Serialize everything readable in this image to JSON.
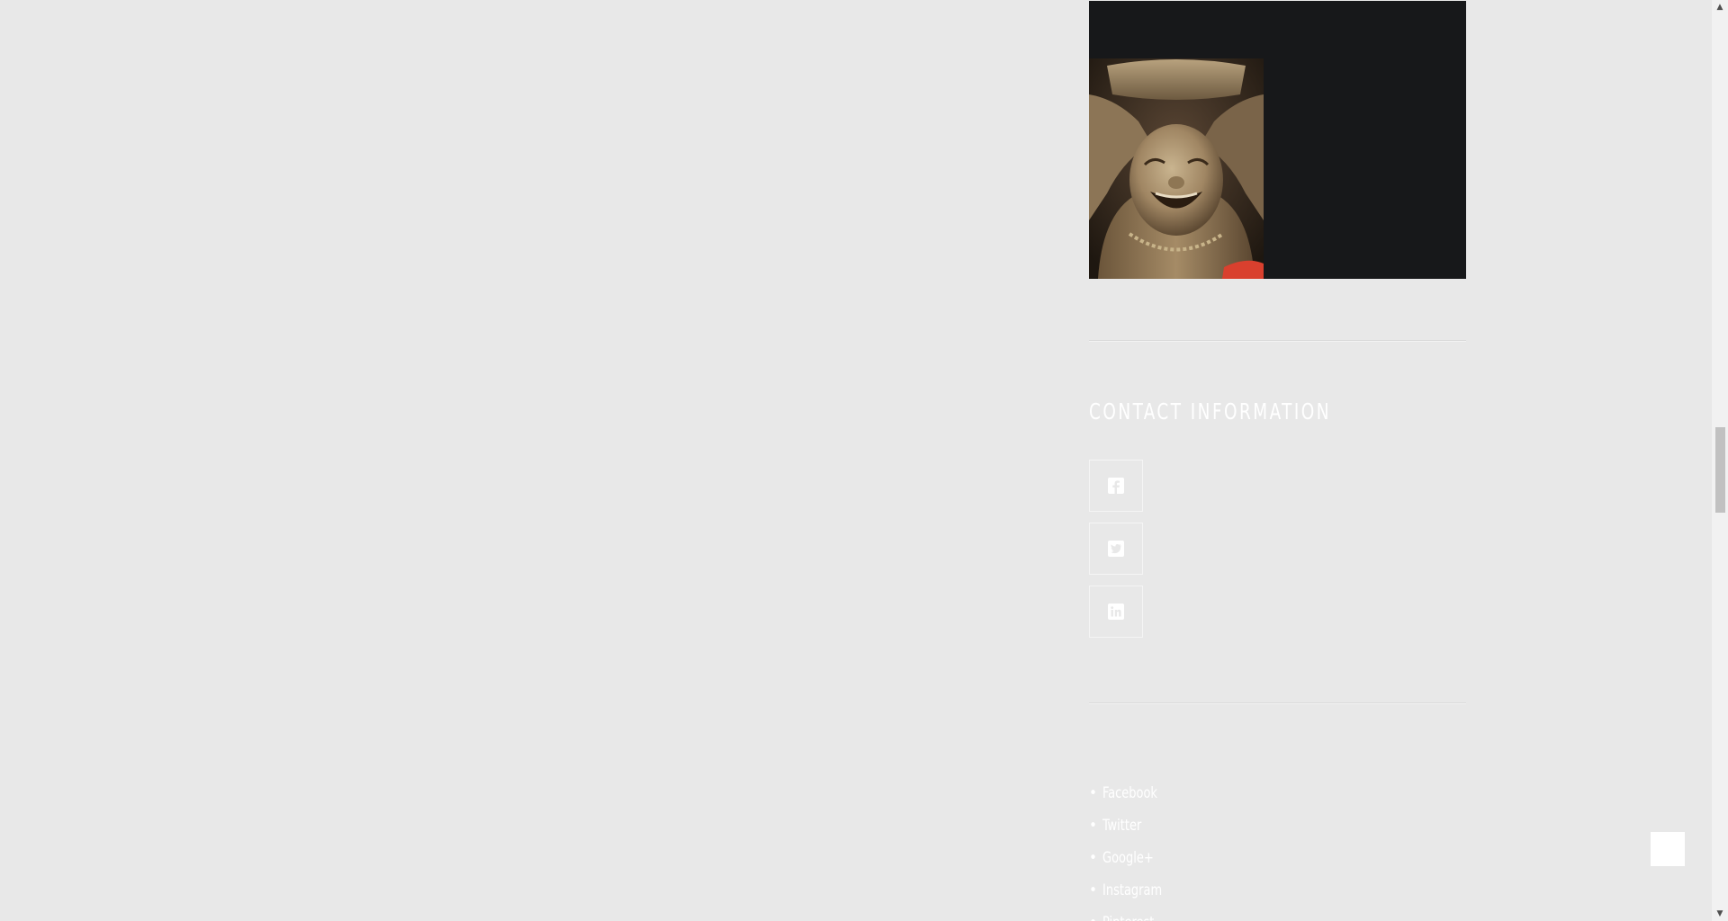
{
  "sidebar": {
    "media": {
      "image_alt": "Laughing Buddha statue"
    },
    "contact": {
      "title": "CONTACT INFORMATION",
      "social_buttons": [
        {
          "icon": "facebook-icon"
        },
        {
          "icon": "twitter-icon"
        },
        {
          "icon": "linkedin-icon"
        }
      ]
    },
    "links": {
      "bullet": "•",
      "items": [
        {
          "label": "Facebook"
        },
        {
          "label": "Twitter"
        },
        {
          "label": "Google+"
        },
        {
          "label": "Instagram"
        },
        {
          "label": "Pinterest"
        }
      ]
    }
  },
  "scrollbar": {
    "up_arrow": "▲",
    "down_arrow": "▼"
  },
  "colors": {
    "page_background": "#e8e8e8",
    "media_background": "#17181a",
    "text": "#ffffff"
  }
}
